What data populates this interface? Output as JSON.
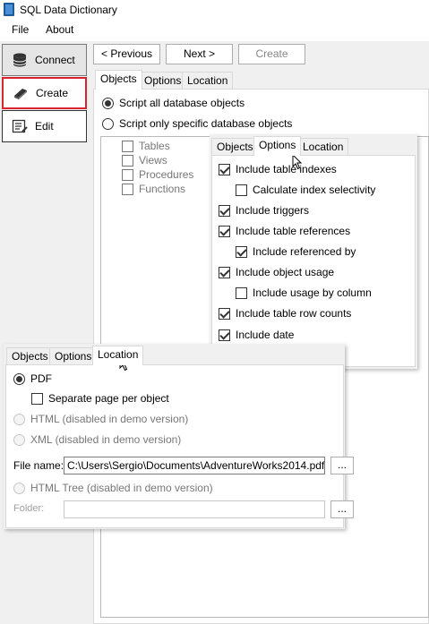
{
  "window": {
    "title": "SQL Data Dictionary"
  },
  "menu": {
    "file": "File",
    "about": "About"
  },
  "nav": {
    "connect": "Connect",
    "create": "Create",
    "edit": "Edit"
  },
  "wizard": {
    "previous": "< Previous",
    "next": "Next >",
    "create": "Create"
  },
  "main_tabs": [
    "Objects",
    "Options",
    "Location"
  ],
  "objects": {
    "script_all": "Script all database objects",
    "script_specific": "Script only specific database objects",
    "types": [
      "Tables",
      "Views",
      "Procedures",
      "Functions"
    ]
  },
  "options_panel": {
    "tabs": [
      "Objects",
      "Options",
      "Location"
    ],
    "items": [
      {
        "label": "Include table indexes",
        "checked": true
      },
      {
        "label": "Calculate index selectivity",
        "checked": false
      },
      {
        "label": "Include triggers",
        "checked": true
      },
      {
        "label": "Include table references",
        "checked": true
      },
      {
        "label": "Include referenced by",
        "checked": true
      },
      {
        "label": "Include object usage",
        "checked": true
      },
      {
        "label": "Include usage by column",
        "checked": false
      },
      {
        "label": "Include table row counts",
        "checked": true
      },
      {
        "label": "Include date",
        "checked": true
      }
    ]
  },
  "location_panel": {
    "tabs": [
      "Objects",
      "Options",
      "Location"
    ],
    "pdf": "PDF",
    "separate_page": "Separate page per object",
    "html": "HTML (disabled in demo version)",
    "xml": "XML (disabled in demo version)",
    "file_name_label": "File name:",
    "file_name_value": "C:\\Users\\Sergio\\Documents\\AdventureWorks2014.pdf",
    "html_tree": "HTML Tree (disabled in demo version)",
    "folder_label": "Folder:",
    "folder_value": "",
    "browse": "..."
  },
  "colors": {
    "highlight_border": "#d9242e",
    "app_icon": "#1e5a96"
  },
  "icons": {
    "app": "book-icon",
    "connect": "database-icon",
    "create": "book-open-icon",
    "edit": "edit-list-icon"
  }
}
